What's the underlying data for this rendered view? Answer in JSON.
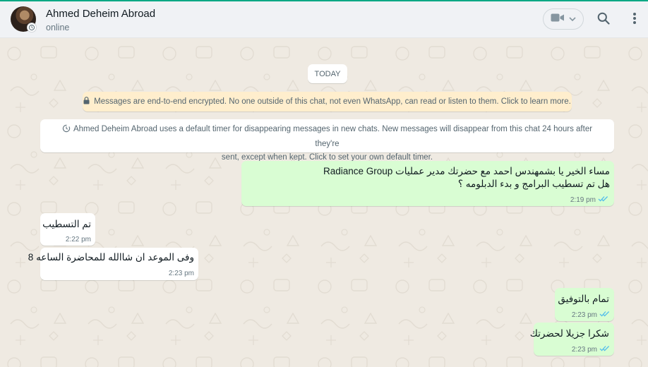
{
  "header": {
    "contact_name": "Ahmed Deheim Abroad",
    "status": "online",
    "icons": [
      "avatar",
      "timer-icon",
      "video-call-icon",
      "chevron-down-icon",
      "search-icon",
      "menu-icon"
    ]
  },
  "chat": {
    "date_label": "TODAY",
    "encryption_notice": "Messages are end-to-end encrypted. No one outside of this chat, not even WhatsApp, can read or listen to them. Click to learn more.",
    "timer_notice_line1": "Ahmed Deheim Abroad uses a default timer for disappearing messages in new chats. New messages will disappear from this chat 24 hours after they're",
    "timer_notice_line2": "sent, except when kept. Click to set your own default timer.",
    "messages": [
      {
        "direction": "outgoing",
        "lines": [
          "مساء الخير يا بشمهندس احمد مع حضرتك مدير عمليات Radiance Group",
          "هل تم تسطيب البرامج و بدء الدبلومه ؟"
        ],
        "time": "2:19 pm",
        "status": "read"
      },
      {
        "direction": "incoming",
        "lines": [
          "تم التسطيب"
        ],
        "time": "2:22 pm"
      },
      {
        "direction": "incoming",
        "lines": [
          "وفى الموعد ان شاالله للمحاضرة الساعه 8"
        ],
        "time": "2:23 pm"
      },
      {
        "direction": "outgoing",
        "lines": [
          "تمام بالتوفيق"
        ],
        "time": "2:23 pm",
        "status": "read"
      },
      {
        "direction": "outgoing",
        "lines": [
          "شكرا جزيلا لحضرتك"
        ],
        "time": "2:23 pm",
        "status": "read"
      }
    ]
  },
  "colors": {
    "accent": "#00a884",
    "outgoing_bubble": "#d9fdd3",
    "incoming_bubble": "#ffffff",
    "chat_background": "#efeae2",
    "encryption_bg": "#ffeecd",
    "read_ticks": "#53bdeb"
  }
}
